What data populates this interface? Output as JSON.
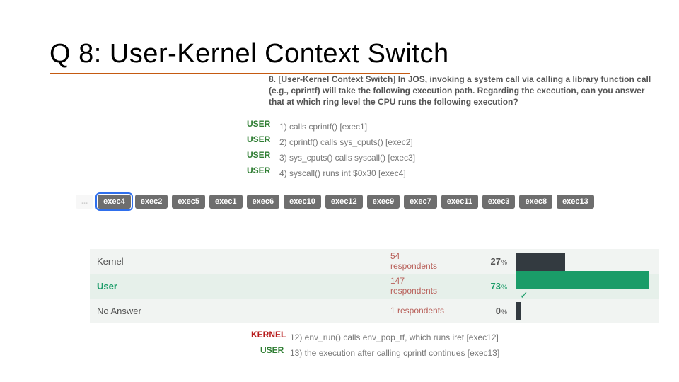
{
  "title": "Q 8: User-Kernel Context Switch",
  "question": "8. [User-Kernel Context Switch] In JOS, invoking a system call via calling a library function call (e.g., cprintf) will take the following execution path. Regarding the execution, can you answer that at which ring level the CPU runs the following execution?",
  "exec_steps": [
    {
      "ann": "USER",
      "text": "1) calls cprintf() [exec1]"
    },
    {
      "ann": "USER",
      "text": "2) cprintf() calls sys_cputs() [exec2]"
    },
    {
      "ann": "USER",
      "text": "3) sys_cputs() calls syscall() [exec3]"
    },
    {
      "ann": "USER",
      "text": "4) syscall() runs int $0x30 [exec4]"
    }
  ],
  "chips": {
    "ghost": "...",
    "items": [
      "exec4",
      "exec2",
      "exec5",
      "exec1",
      "exec6",
      "exec10",
      "exec12",
      "exec9",
      "exec7",
      "exec11",
      "exec3",
      "exec8",
      "exec13"
    ]
  },
  "results": [
    {
      "label": "Kernel",
      "resp_n": "54",
      "resp_t": "respondents",
      "pct": "27",
      "bar": 70,
      "ok": false
    },
    {
      "label": "User",
      "resp_n": "147",
      "resp_t": "respondents",
      "pct": "73",
      "bar": 188,
      "ok": true
    },
    {
      "label": "No Answer",
      "resp_n": "1 respondents",
      "resp_t": "",
      "pct": "0",
      "bar": 8,
      "ok": false
    }
  ],
  "bottom_steps": [
    {
      "ann": "KERNEL",
      "text": "12) env_run() calls env_pop_tf, which runs iret [exec12]"
    },
    {
      "ann": "USER",
      "text": "13) the execution after calling cprintf continues [exec13]"
    }
  ]
}
